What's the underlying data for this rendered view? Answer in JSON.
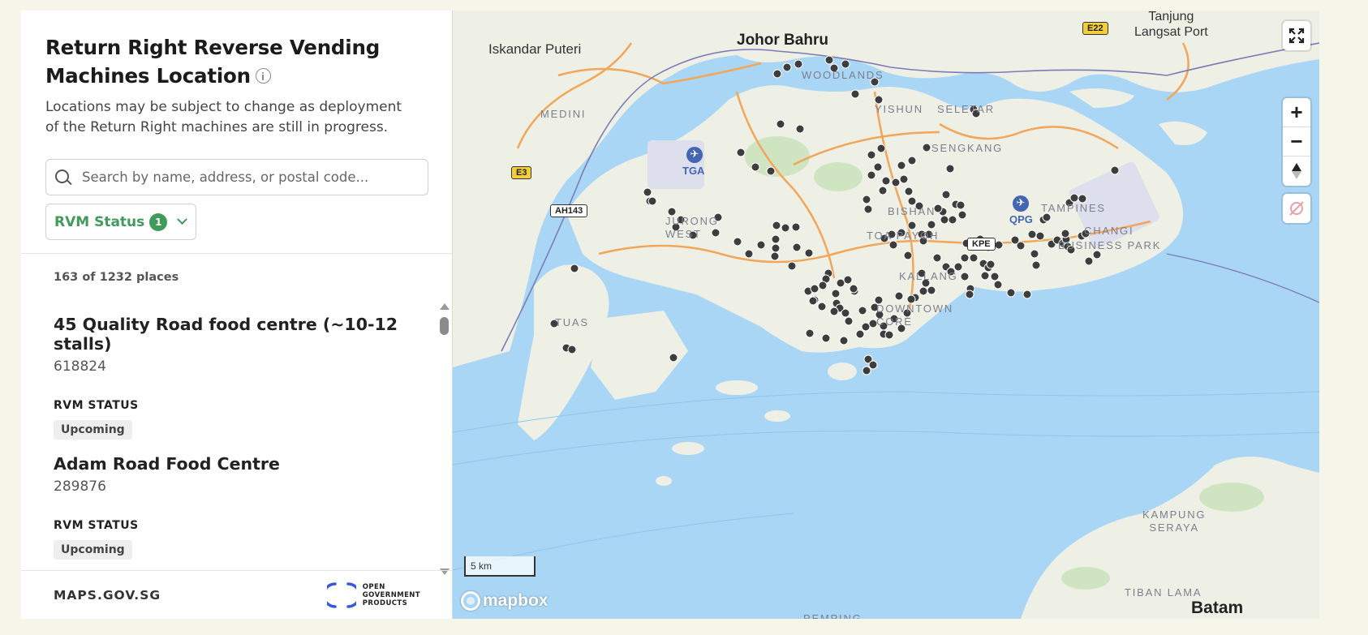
{
  "panel": {
    "title": "Return Right Reverse Vending Machines Location",
    "subtitle": "Locations may be subject to change as deployment of the Return Right machines are still in progress.",
    "search_placeholder": "Search by name, address, or postal code...",
    "filter_label": "RVM Status",
    "filter_count": "1",
    "results_count": "163 of 1232 places",
    "status_label": "RVM STATUS",
    "places": [
      {
        "name": "45 Quality Road food centre (~10-12 stalls)",
        "postal": "618824",
        "status": "Upcoming"
      },
      {
        "name": "Adam Road Food Centre",
        "postal": "289876",
        "status": "Upcoming"
      }
    ],
    "footer_brand": "MAPS.GOV.SG",
    "ogp_line1": "OPEN",
    "ogp_line2": "GOVERNMENT",
    "ogp_line3": "PRODUCTS"
  },
  "map": {
    "labels": {
      "johor_bahru": "Johor Bahru",
      "iskandar_puteri": "Iskandar Puteri",
      "tanjung_line1": "Tanjung",
      "tanjung_line2": "Langsat Port",
      "medini": "MEDINI",
      "woodlands": "WOODLANDS",
      "yishun": "YISHUN",
      "seletar": "SELETAR",
      "sengkang": "SENGKANG",
      "tga": "TGA",
      "jurong_line1": "JURONG",
      "jurong_line2": "WEST",
      "bishan": "BISHAN",
      "toa_payoh": "TOA PAYOH",
      "qpg": "QPG",
      "tampines": "TAMPINES",
      "changi": "CHANGI",
      "business_park": "BUSINESS PARK",
      "kallang": "KALLANG",
      "downtown_line1": "DOWNTOWN",
      "downtown_line2": "CORE",
      "tuas": "TUAS",
      "kampung_line1": "KAMPUNG",
      "kampung_line2": "SERAYA",
      "tiban_lama": "TIBAN LAMA",
      "batam": "Batam",
      "pemping": "PEMPING",
      "kpe": "KPE"
    },
    "shields": {
      "e3": "E3",
      "e22": "E22",
      "ah143": "AH143"
    },
    "scale_text": "5 km",
    "attribution": "mapbox",
    "colors": {
      "water": "#a9d6f5",
      "land": "#eef0e6",
      "marker": "#3d3d3d",
      "accent_green": "#3f9a5b"
    }
  }
}
